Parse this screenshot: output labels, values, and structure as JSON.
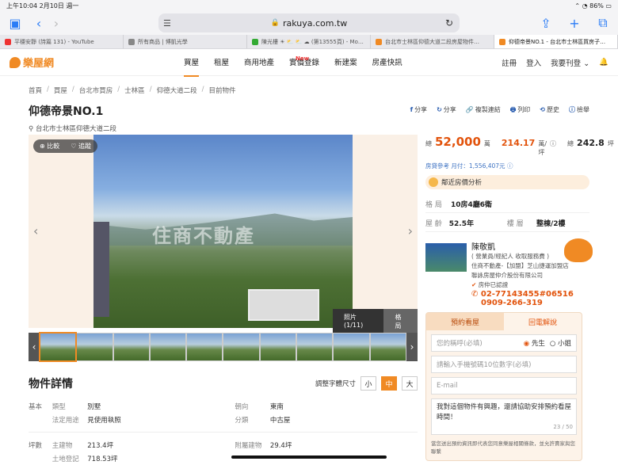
{
  "status": {
    "time": "上午10:04",
    "date": "2月10日 週一",
    "battery": "86%"
  },
  "browser": {
    "url": "rakuya.com.tw",
    "tabs": [
      {
        "label": "平穩安靜 (詩篇 131) - YouTube",
        "color": "#e33"
      },
      {
        "label": "所有商品 | 博凱光學",
        "color": "#888"
      },
      {
        "label": "陳光樓 ☀ ⛅ ⛅ ☁ (第13555頁) - Mo…",
        "color": "#3a3"
      },
      {
        "label": "台北市士林區仰德大道二段房屋物件…",
        "color": "#f08a24"
      },
      {
        "label": "仰德帝景NO.1 - 台北市士林區買房子…",
        "color": "#f08a24"
      }
    ]
  },
  "site": {
    "logo": "樂屋網",
    "menu": [
      {
        "label": "買屋"
      },
      {
        "label": "租屋"
      },
      {
        "label": "商用地產"
      },
      {
        "label": "實價登錄",
        "badge": "New"
      },
      {
        "label": "新建案"
      },
      {
        "label": "房產快訊"
      }
    ],
    "login": "註冊",
    "signin": "登入",
    "sell": "我要刊登"
  },
  "breadcrumb": [
    "首頁",
    "買屋",
    "台北市買房",
    "士林區",
    "仰德大道二段",
    "目前物件"
  ],
  "listing": {
    "title": "仰德帝景NO.1",
    "address": "台北市士林區仰德大道二段",
    "actions": [
      "分享",
      "分享",
      "複製連結",
      "列印",
      "歷史",
      "檢舉"
    ],
    "gallery": {
      "compare": "比較",
      "follow": "追蹤",
      "photos": "照片(1/11)",
      "layout": "格局",
      "watermark": "住商不動產"
    },
    "price": {
      "total_label": "總",
      "total": "52,000",
      "total_unit": "萬",
      "unit_price": "214.17",
      "unit_price_unit": "萬/坪",
      "area_label": "總",
      "area": "242.8",
      "area_unit": "坪"
    },
    "ref": "房貸參考 月付：1,556,407元",
    "analysis": "鄰近房價分析",
    "specs": [
      {
        "k": "格 局",
        "v": "10房4廳6衛"
      },
      {
        "k": "屋 齡",
        "v": "52.5年",
        "k2": "樓 層",
        "v2": "整棟/2樓"
      }
    ]
  },
  "agent": {
    "name": "陳敬凱",
    "role": "( 營業員/經紀人 收取服務費 )",
    "company": "住商不動產-【加盟】芝山捷運加盟店",
    "company2": "聯詠房屋仲介股份有限公司",
    "verified": "房仲已認證",
    "phone1": "02-77143455#06516",
    "phone2": "0909-266-319"
  },
  "form": {
    "tab1": "預約看屋",
    "tab2": "回電解說",
    "name_ph": "您的稱呼(必填)",
    "male": "先生",
    "female": "小姐",
    "phone_ph": "請輸入手機號碼10位數字(必填)",
    "email_ph": "E-mail",
    "message": "我對這個物件有興趣，還請協助安排預約看屋時間！",
    "count": "23 / 50",
    "note": "當您送出預約資訊即代表您同意樂屋相關條款，並允許賣家與您聯繫"
  },
  "details": {
    "title": "物件詳情",
    "font_label": "調整字體尺寸",
    "sizes": [
      "小",
      "中",
      "大"
    ],
    "rows": [
      {
        "c": "基本",
        "k": "類型",
        "v": "別墅",
        "k2": "朝向",
        "v2": "東南"
      },
      {
        "c": "",
        "k": "法定用途",
        "v": "見使用執照",
        "k2": "分類",
        "v2": "中古屋"
      },
      {
        "c": "坪數",
        "k": "主建物",
        "v": "213.4坪",
        "k2": "附屬建物",
        "v2": "29.4坪"
      },
      {
        "c": "",
        "k": "土地登記",
        "v": "718.53坪",
        "k2": "",
        "v2": ""
      }
    ]
  }
}
